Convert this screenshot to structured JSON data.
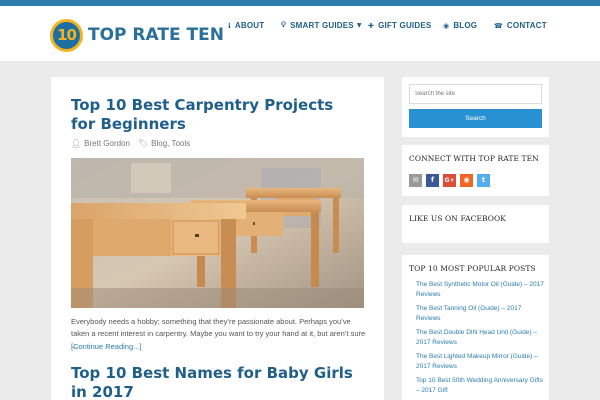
{
  "site": {
    "logo_badge": "10",
    "logo_text": "TOP RATE TEN",
    "colors": {
      "accent": "#2c7dae",
      "logo_yellow": "#f3b321",
      "button_blue": "#2891d2"
    }
  },
  "nav": {
    "items": [
      {
        "label": "ABOUT",
        "icon": "info-icon"
      },
      {
        "label": "SMART GUIDES",
        "icon": "lightbulb-icon",
        "has_dropdown": true
      },
      {
        "label": "GIFT GUIDES",
        "icon": "gift-icon"
      },
      {
        "label": "BLOG",
        "icon": "rss-icon"
      },
      {
        "label": "CONTACT",
        "icon": "phone-icon"
      }
    ]
  },
  "posts": [
    {
      "title": "Top 10 Best Carpentry Projects for Beginners",
      "author": "Brett Gordon",
      "categories": "Blog, Tools",
      "excerpt": "Everybody needs a hobby; something that they’re passionate about. Perhaps you’ve taken a recent interest in carpentry. Maybe you want to try your hand at it, but aren’t sure …",
      "read_more": "[Continue Reading...]"
    },
    {
      "title": "Top 10 Best Names for Baby Girls in 2017"
    }
  ],
  "sidebar": {
    "search": {
      "placeholder": "Search the site",
      "button_label": "Search"
    },
    "connect": {
      "title": "CONNECT WITH TOP RATE TEN",
      "icons": [
        {
          "name": "email-icon",
          "glyph": "✉",
          "color": "#999999"
        },
        {
          "name": "facebook-icon",
          "glyph": "f",
          "color": "#3b5998"
        },
        {
          "name": "google-plus-icon",
          "glyph": "G+",
          "color": "#dd4b39"
        },
        {
          "name": "rss-icon",
          "glyph": "◉",
          "color": "#f26522"
        },
        {
          "name": "twitter-icon",
          "glyph": "t",
          "color": "#55acee"
        }
      ]
    },
    "facebook": {
      "title": "LIKE US ON FACEBOOK"
    },
    "popular": {
      "title": "TOP 10 MOST POPULAR POSTS",
      "items": [
        "The Best Synthetic Motor Oil (Guide) – 2017 Reviews",
        "The Best Tanning Oil (Guide) – 2017 Reviews",
        "The Best Double DIN Head Unit (Guide) – 2017 Reviews",
        "The Best Lighted Makeup Mirror (Guide) – 2017 Reviews",
        "Top 10 Best 50th Wedding Anniversary Gifts – 2017 Gift"
      ]
    }
  }
}
